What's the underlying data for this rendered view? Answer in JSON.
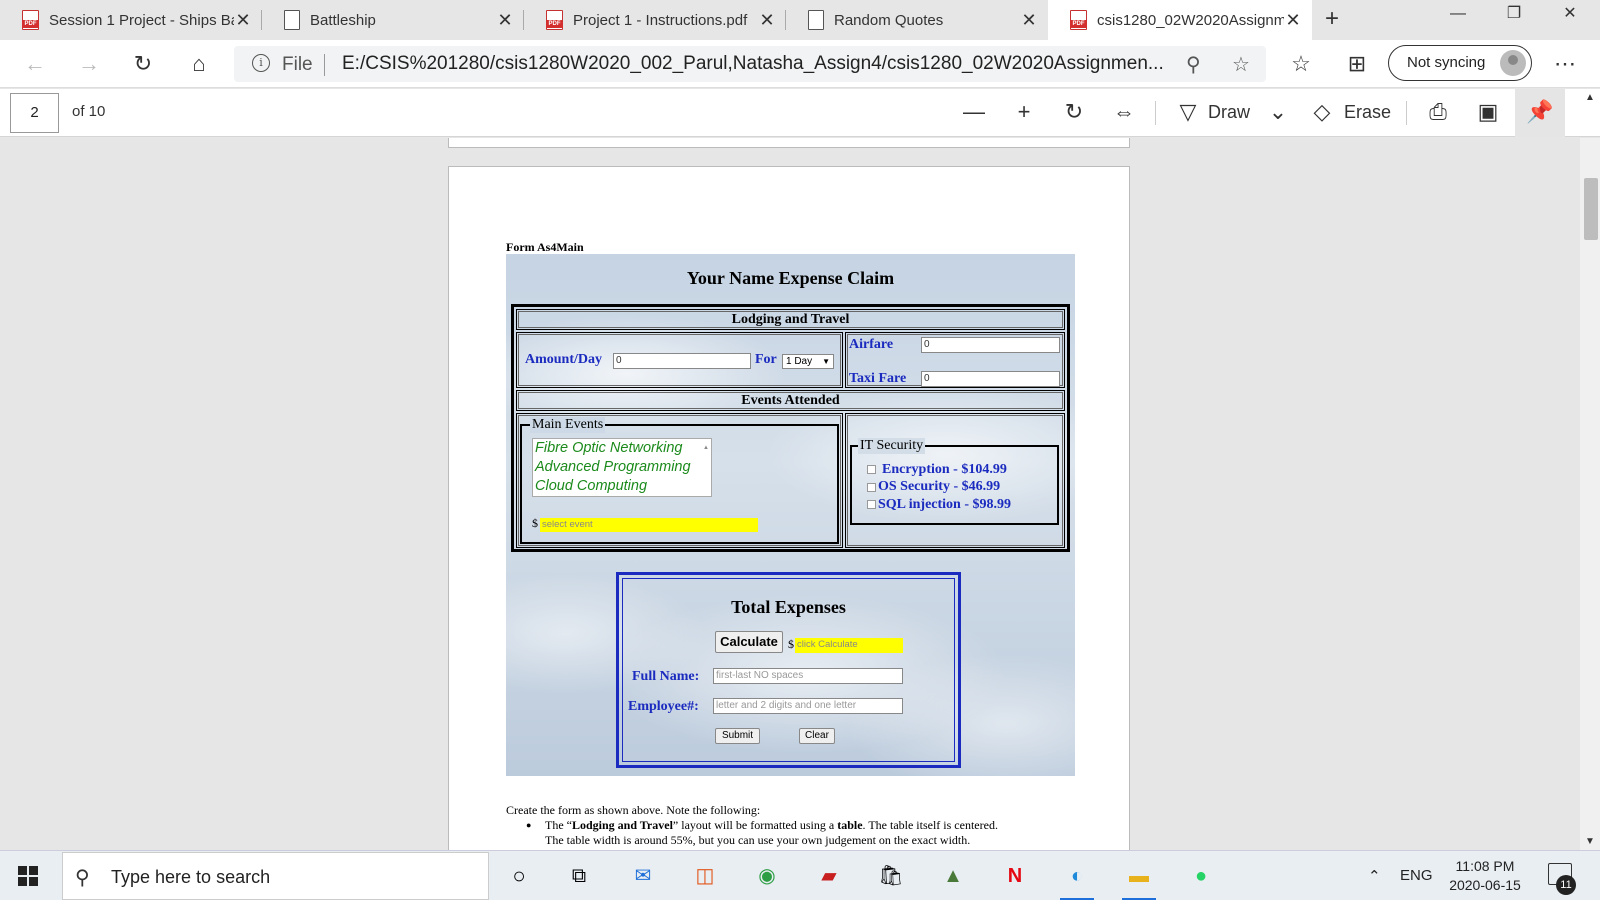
{
  "tabs": [
    {
      "title": "Session 1 Project - Ships Ba",
      "icon": "pdf-icon",
      "active": false
    },
    {
      "title": "Battleship",
      "icon": "document-icon",
      "active": false
    },
    {
      "title": "Project 1 - Instructions.pdf",
      "icon": "pdf-icon",
      "active": false
    },
    {
      "title": "Random Quotes",
      "icon": "document-icon",
      "active": false
    },
    {
      "title": "csis1280_02W2020Assignm",
      "icon": "pdf-icon",
      "active": true
    }
  ],
  "address": {
    "scheme_label": "File",
    "url": "E:/CSIS%201280/csis1280W2020_002_Parul,Natasha_Assign4/csis1280_02W2020Assignmen..."
  },
  "profile": {
    "sync_label": "Not syncing"
  },
  "pdf_toolbar": {
    "page_number": "2",
    "page_count": "of 10",
    "draw_label": "Draw",
    "erase_label": "Erase"
  },
  "document": {
    "caption": "Form As4Main",
    "form_title": "Your Name Expense Claim",
    "lodging_header": "Lodging and Travel",
    "amount_label": "Amount/Day",
    "amount_value": "0",
    "for_label": "For",
    "for_value": "1 Day",
    "airfare_label": "Airfare",
    "airfare_value": "0",
    "taxi_label": "Taxi Fare",
    "taxi_value": "0",
    "events_header": "Events Attended",
    "main_events_legend": "Main Events",
    "main_events": [
      "Fibre Optic Networking",
      "Advanced Programming",
      "Cloud Computing"
    ],
    "dollar_sign": "$",
    "event_cost_placeholder": "select event",
    "it_security_legend": "IT Security",
    "it_security_items": [
      "Encryption - $104.99",
      "OS Security - $46.99",
      "SQL injection - $98.99"
    ],
    "total_title": "Total Expenses",
    "calculate_label": "Calculate",
    "total_placeholder": "click Calculate",
    "fullname_label": "Full Name:",
    "fullname_placeholder": "first-last NO spaces",
    "employee_label": "Employee#:",
    "employee_placeholder": "letter and 2 digits and one letter",
    "submit_label": "Submit",
    "clear_label": "Clear",
    "instructions_intro": "Create the form as shown above. Note the following:",
    "bullet_1_pre": "The “",
    "bullet_1_bold1": "Lodging and Travel",
    "bullet_1_mid": "” layout will be formatted using a ",
    "bullet_1_bold2": "table",
    "bullet_1_post": ". The table itself is centered.",
    "bullet_1_line2": "The table width is around 55%, but you can use your own judgement on the exact width."
  },
  "taskbar": {
    "search_placeholder": "Type here to search",
    "language": "ENG",
    "time": "11:08 PM",
    "date": "2020-06-15",
    "notification_count": "11"
  }
}
